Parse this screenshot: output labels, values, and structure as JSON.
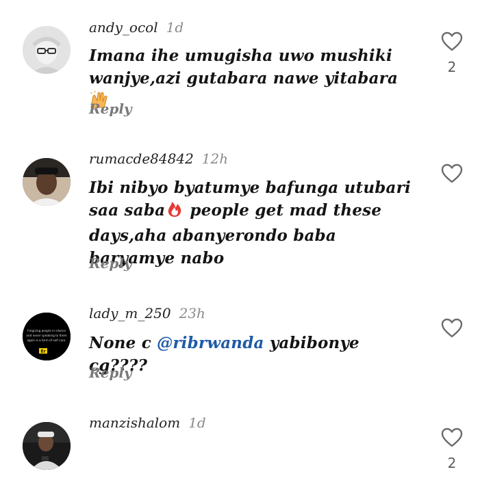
{
  "colors": {
    "text": "#141414",
    "muted": "#8a8a8a",
    "mention": "#1e5aa8",
    "heart_stroke": "#6b6b6b",
    "fire": "#e53935",
    "clap": "#f2a33a"
  },
  "comments": [
    {
      "username": "andy_ocol",
      "time": "1d",
      "text_before": "Imana ihe umugisha uwo mushiki wanjye,azi gutabara nawe yitabara",
      "emoji": "clapping-hands-icon",
      "reply_label": "Reply",
      "like_count": "2"
    },
    {
      "username": "rumacde84842",
      "time": "12h",
      "text_before": "Ibi nibyo byatumye bafunga utubari saa saba",
      "emoji": "fire-icon",
      "text_after": " people get mad these days,aha abanyerondo baba baryamye nabo",
      "reply_label": "Reply",
      "like_count": ""
    },
    {
      "username": "lady_m_250",
      "time": "23h",
      "text_before": "None c ",
      "mention": "@ribrwanda",
      "text_after": " yabibonye cg????",
      "reply_label": "Reply",
      "like_count": "",
      "avatar_lines": [
        "Forgiving people in silence",
        "and never speaking to them",
        "again is a form of self care."
      ],
      "avatar_badge": "Er"
    },
    {
      "username": "manzishalom",
      "time": "1d",
      "like_count": "2"
    }
  ]
}
